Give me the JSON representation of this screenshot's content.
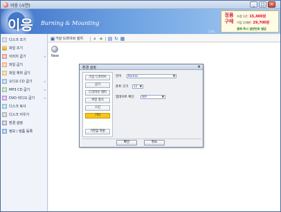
{
  "window": {
    "title": "이응 (시연)"
  },
  "banner": {
    "logo": "이응",
    "subtitle": "Burning & Mounting",
    "version": "2.63",
    "promo": {
      "big": "정품구매",
      "line1_label": "가정 1년:",
      "line1_price": "15,400원",
      "line2_label": "기업 무제한:",
      "line2_price": "29,700원",
      "line3": "결제 즉시 일련번호 발급"
    }
  },
  "sidebar": {
    "items": [
      {
        "label": "디스크 조기",
        "arrow": ""
      },
      {
        "label": "파일 조기",
        "arrow": ""
      },
      {
        "label": "이미지 굽기",
        "arrow": "»"
      },
      {
        "label": "파일 굽기",
        "arrow": ""
      },
      {
        "label": "파일 체취 굽기",
        "arrow": ""
      },
      {
        "label": "오디오 CD 굽기",
        "arrow": "»"
      },
      {
        "label": "MP3 CD 굽기",
        "arrow": "»"
      },
      {
        "label": "DVD 비디오 굽기",
        "arrow": "»"
      },
      {
        "label": "디스크 복사",
        "arrow": ""
      },
      {
        "label": "디스크 지우기",
        "arrow": ""
      },
      {
        "label": "환경 설정",
        "arrow": ""
      },
      {
        "label": "정보 / 정품 등록",
        "arrow": ""
      }
    ]
  },
  "toolbar": {
    "install_label": "가상 드라이브 설치"
  },
  "main": {
    "new_label": "New"
  },
  "dialog": {
    "title": "환경 설정",
    "tabs": [
      "가상 드라이브",
      "굽기",
      "드라이브 제어",
      "파일 형식",
      "스킨",
      "기타"
    ],
    "active_tab": "기타",
    "reset_label": "기본값 복원",
    "options": {
      "language_label": "언어",
      "language_value": "Korean",
      "fontsize_label": "폰트 크기",
      "fontsize_value": "12",
      "update_label": "업데이트 확인",
      "update_value": "매주"
    },
    "ok_label": "확인",
    "cancel_label": "취소"
  }
}
